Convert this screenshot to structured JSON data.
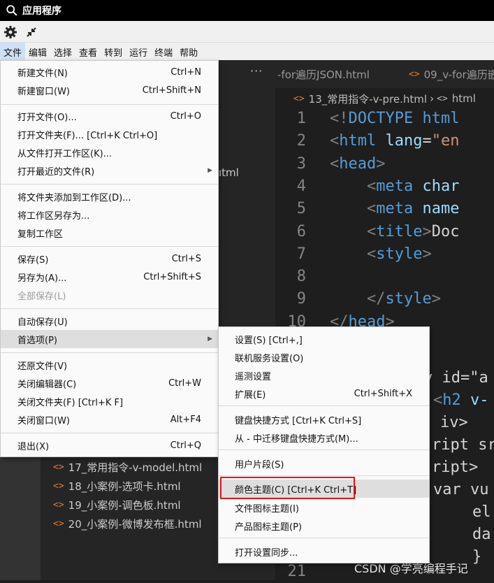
{
  "window": {
    "title": "应用程序"
  },
  "menubar": [
    "文件",
    "编辑",
    "选择",
    "查看",
    "转到",
    "运行",
    "终端",
    "帮助"
  ],
  "explorer": {
    "peek_text": "ıtml",
    "files": [
      "17_常用指令-v-model.html",
      "18_小案例-选项卡.html",
      "19_小案例-调色板.html",
      "20_小案例-微博发布框.html"
    ]
  },
  "editor": {
    "tabs": [
      "-for遍历JSON.html",
      "09_v-for遍历嵌"
    ],
    "breadcrumb": {
      "file": "13_常用指令-v-pre.html",
      "node": "html"
    },
    "lines": [
      {
        "num": "1",
        "text": "<!DOCTYPE html"
      },
      {
        "num": "2",
        "text": "<html lang=\"en"
      },
      {
        "num": "3",
        "text": "<head>"
      },
      {
        "num": "4",
        "text": "    <meta char"
      },
      {
        "num": "5",
        "text": "    <meta name"
      },
      {
        "num": "6",
        "text": "    <title>Doc"
      },
      {
        "num": "7",
        "text": "    <style>"
      },
      {
        "num": "8",
        "text": ""
      },
      {
        "num": "9",
        "text": "    </style>"
      },
      {
        "num": "10",
        "text": "</head>"
      }
    ],
    "peek_lines": [
      "v id=\"a",
      "<h2 v-",
      "iv>",
      "ript sr",
      "ript>",
      "var vu",
      "el",
      "da",
      "}"
    ],
    "last_line_num": "21"
  },
  "file_menu": {
    "items": [
      {
        "label": "新建文件(N)",
        "shortcut": "Ctrl+N"
      },
      {
        "label": "新建窗口(W)",
        "shortcut": "Ctrl+Shift+N"
      },
      {
        "label": "打开文件(O)...",
        "shortcut": "Ctrl+O"
      },
      {
        "label": "打开文件夹(F)... [Ctrl+K Ctrl+O]",
        "shortcut": ""
      },
      {
        "label": "从文件打开工作区(K)...",
        "shortcut": ""
      },
      {
        "label": "打开最近的文件(R)",
        "shortcut": ""
      },
      {
        "label": "将文件夹添加到工作区(D)...",
        "shortcut": ""
      },
      {
        "label": "将工作区另存为...",
        "shortcut": ""
      },
      {
        "label": "复制工作区",
        "shortcut": ""
      },
      {
        "label": "保存(S)",
        "shortcut": "Ctrl+S"
      },
      {
        "label": "另存为(A)...",
        "shortcut": "Ctrl+Shift+S"
      },
      {
        "label": "全部保存(L)",
        "shortcut": ""
      },
      {
        "label": "自动保存(U)",
        "shortcut": ""
      },
      {
        "label": "首选项(P)",
        "shortcut": ""
      },
      {
        "label": "还原文件(V)",
        "shortcut": ""
      },
      {
        "label": "关闭编辑器(C)",
        "shortcut": "Ctrl+W"
      },
      {
        "label": "关闭文件夹(F) [Ctrl+K F]",
        "shortcut": ""
      },
      {
        "label": "关闭窗口(W)",
        "shortcut": "Alt+F4"
      },
      {
        "label": "退出(X)",
        "shortcut": "Ctrl+Q"
      }
    ]
  },
  "pref_menu": {
    "items": [
      {
        "label": "设置(S) [Ctrl+,]",
        "shortcut": ""
      },
      {
        "label": "联机服务设置(O)",
        "shortcut": ""
      },
      {
        "label": "遥测设置",
        "shortcut": ""
      },
      {
        "label": "扩展(E)",
        "shortcut": "Ctrl+Shift+X"
      },
      {
        "label": "键盘快捷方式 [Ctrl+K Ctrl+S]",
        "shortcut": ""
      },
      {
        "label": "从 - 中迁移键盘快捷方式(M)...",
        "shortcut": ""
      },
      {
        "label": "用户片段(S)",
        "shortcut": ""
      },
      {
        "label": "颜色主题(C) [Ctrl+K Ctrl+T]",
        "shortcut": ""
      },
      {
        "label": "文件图标主题(I)",
        "shortcut": ""
      },
      {
        "label": "产品图标主题(P)",
        "shortcut": ""
      },
      {
        "label": "打开设置同步...",
        "shortcut": ""
      }
    ]
  },
  "watermark": "CSDN @学亮编程手记",
  "colors": {
    "highlight_border": "#e0141e",
    "file_icon": "#e37933",
    "tag": "#569cd6"
  }
}
